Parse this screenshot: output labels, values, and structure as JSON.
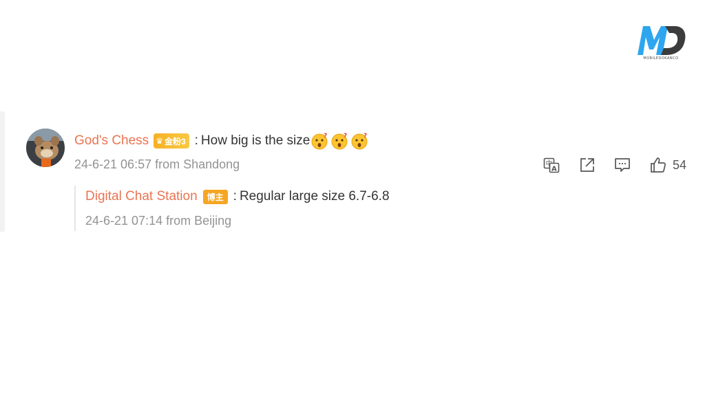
{
  "logo": {
    "letters": "MD",
    "caption": "MOBILEDOKANCO",
    "colors": {
      "blue": "#2ea6ef",
      "dark": "#3c3c3c"
    }
  },
  "comment": {
    "username": "God's Chess",
    "fan_badge": {
      "icon": "crown-heart-icon",
      "label": "金粉3"
    },
    "separator": ":",
    "text": "How big is the size",
    "emojis": [
      "surprised-emoji",
      "surprised-emoji",
      "surprised-emoji"
    ],
    "meta": "24-6-21 06:57 from Shandong",
    "actions": {
      "translate": "translate-icon",
      "share": "share-icon",
      "reply": "comment-icon",
      "like": "thumbs-up-icon",
      "like_count": "54"
    }
  },
  "reply": {
    "username": "Digital Chat Station",
    "host_badge": "博主",
    "separator": ":",
    "text": "Regular large size 6.7-6.8",
    "meta": "24-6-21 07:14 from Beijing"
  },
  "colors": {
    "username": "#eb7350",
    "meta": "#939393",
    "text": "#333333",
    "badge": "#f5a623"
  }
}
